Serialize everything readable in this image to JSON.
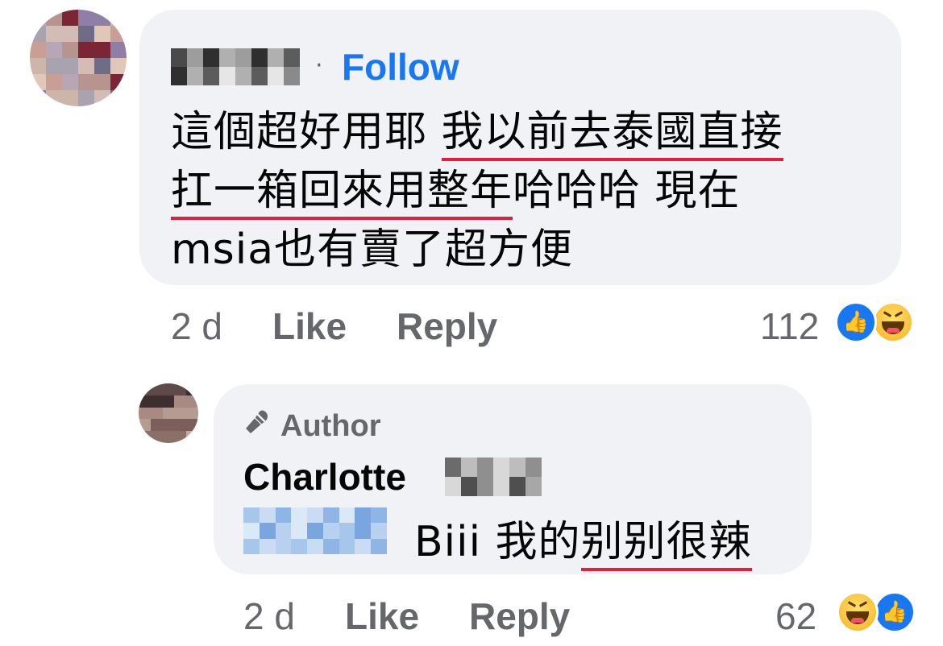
{
  "comment": {
    "follow_separator": "·",
    "follow_label": "Follow",
    "text_lines": [
      {
        "plain": "這個超好用耶 ",
        "underlined": "我以前去泰國直接",
        "after": ""
      },
      {
        "plain": "",
        "underlined": "扛一箱回來用整年",
        "after": "哈哈哈 現在"
      },
      {
        "plain": "msia也有賣了超方便",
        "underlined": "",
        "after": ""
      }
    ],
    "time": "2 d",
    "like_label": "Like",
    "reply_label": "Reply",
    "reaction_count": "112",
    "reactions": [
      "like-icon",
      "haha-icon"
    ]
  },
  "reply": {
    "badge_icon": "microphone-icon",
    "badge_label": "Author",
    "author_name": "Charlotte",
    "text_plain": "Biii 我的",
    "text_underlined": "别别很辣",
    "time": "2 d",
    "like_label": "Like",
    "reply_label": "Reply",
    "reaction_count": "62",
    "reactions": [
      "haha-icon",
      "like-icon"
    ]
  },
  "colors": {
    "bubble": "#f0f2f5",
    "follow": "#1877f2",
    "meta": "#65676b",
    "underline": "#e41e3f",
    "like_blue": "#1877f2"
  }
}
